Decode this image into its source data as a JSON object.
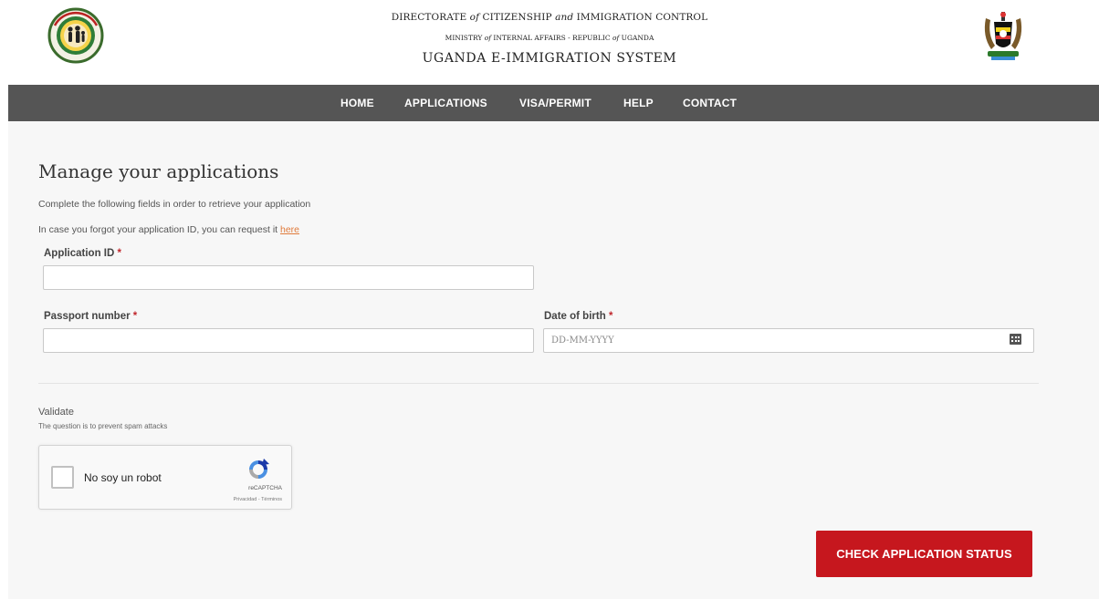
{
  "header": {
    "line1_a": "DIRECTORATE ",
    "line1_of": "of",
    "line1_b": " CITIZENSHIP ",
    "line1_and": "and",
    "line1_c": " IMMIGRATION CONTROL",
    "line2_a": "MINISTRY ",
    "line2_of": "of",
    "line2_b": " INTERNAL AFFAIRS - REPUBLIC ",
    "line2_of2": "of",
    "line2_c": " UGANDA",
    "system_title": "UGANDA E-IMMIGRATION SYSTEM",
    "left_logo_icon": "immigration-seal-icon",
    "right_logo_icon": "uganda-coat-of-arms-icon"
  },
  "nav": {
    "items": [
      {
        "label": "HOME"
      },
      {
        "label": "APPLICATIONS"
      },
      {
        "label": "VISA/PERMIT"
      },
      {
        "label": "HELP"
      },
      {
        "label": "CONTACT"
      }
    ]
  },
  "main": {
    "title": "Manage your applications",
    "description": "Complete the following fields in order to retrieve your application",
    "forgot_text": "In case you forgot your application ID, you can request it ",
    "forgot_link": "here",
    "required_mark": "*",
    "fields": {
      "application_id": {
        "label": "Application ID",
        "value": "",
        "placeholder": ""
      },
      "passport_number": {
        "label": "Passport number",
        "value": "",
        "placeholder": ""
      },
      "date_of_birth": {
        "label": "Date of birth",
        "value": "",
        "placeholder": "DD-MM-YYYY",
        "icon": "calendar-icon"
      }
    },
    "validate": {
      "title": "Validate",
      "subtitle": "The question is to prevent spam attacks"
    },
    "captcha": {
      "label": "No soy un robot",
      "brand": "reCAPTCHA",
      "terms": "Privacidad - Términos",
      "checked": false
    },
    "submit_label": "CHECK APPLICATION STATUS"
  },
  "colors": {
    "nav_bg": "#555555",
    "submit_bg": "#c6171e",
    "required": "#c0272d",
    "link": "#e07b3c"
  }
}
